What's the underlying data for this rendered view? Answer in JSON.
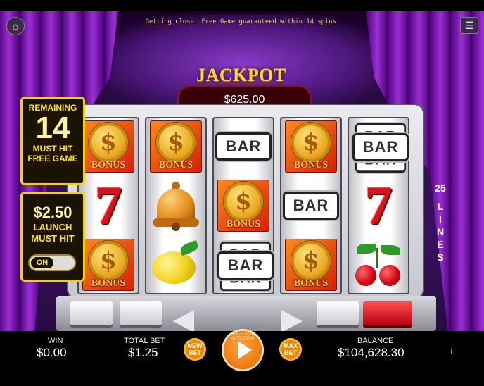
{
  "header": {
    "ticker": "Getting close! Free Game guaranteed within 14 spins!",
    "home_icon": "home-icon",
    "menu_icon": "menu-icon"
  },
  "jackpot": {
    "title": "JACKPOT",
    "amount": "$625.00"
  },
  "remaining_panel": {
    "label": "REMAINING",
    "count": "14",
    "must_hit": "MUST HIT",
    "free_game": "FREE GAME"
  },
  "launch_panel": {
    "amount": "$2.50",
    "launch": "LAUNCH",
    "must_hit": "MUST HIT",
    "toggle_state": "ON"
  },
  "lines": {
    "count": "25",
    "word": "LINES"
  },
  "symbols": {
    "bonus_coin": "$",
    "bonus_word": "BONUS",
    "bar_word": "BAR",
    "seven": "7"
  },
  "reels": [
    [
      "bonus",
      "seven",
      "bonus"
    ],
    [
      "bonus",
      "bell",
      "lemon"
    ],
    [
      "bar",
      "bonus",
      "bar-stack"
    ],
    [
      "bonus",
      "bar",
      "bonus"
    ],
    [
      "bar-stack",
      "seven",
      "cherry"
    ]
  ],
  "bottom": {
    "win_label": "WIN",
    "win_value": "$0.00",
    "total_bet_label": "TOTAL BET",
    "total_bet_value": "$1.25",
    "new_bet": "NEW BET",
    "max_bet": "MAX BET",
    "autospin_hint": "HOLD FOR AUTOSPIN",
    "balance_label": "BALANCE",
    "balance_value": "$104,628.30",
    "info": "i"
  }
}
